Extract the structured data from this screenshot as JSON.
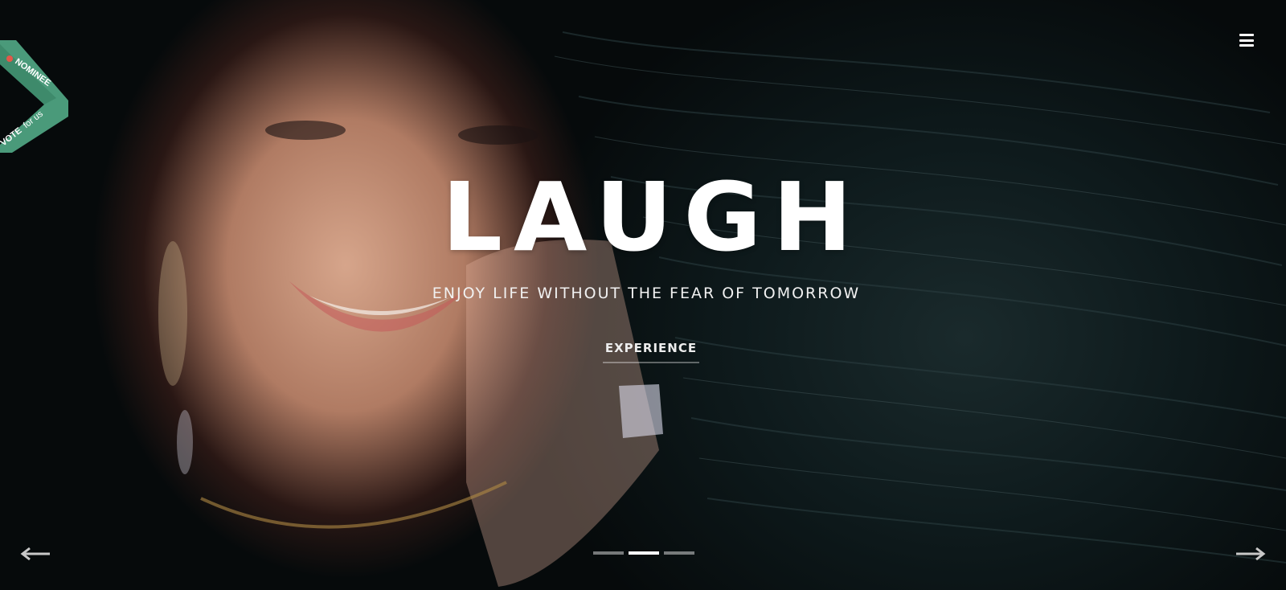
{
  "hero": {
    "headline": "LAUGH",
    "subtitle": "ENJOY LIFE WITHOUT THE FEAR OF TOMORROW",
    "cta_label": "EXPERIENCE"
  },
  "badge": {
    "top_text": "NOMINEE",
    "bottom_text_bold": "VOTE",
    "bottom_text": "for us",
    "color": "#4a9a7a"
  },
  "nav": {
    "menu_icon": "hamburger-icon",
    "prev_icon": "arrow-left-icon",
    "next_icon": "arrow-right-icon"
  },
  "slider": {
    "slide_count": 3,
    "active_index": 1
  }
}
